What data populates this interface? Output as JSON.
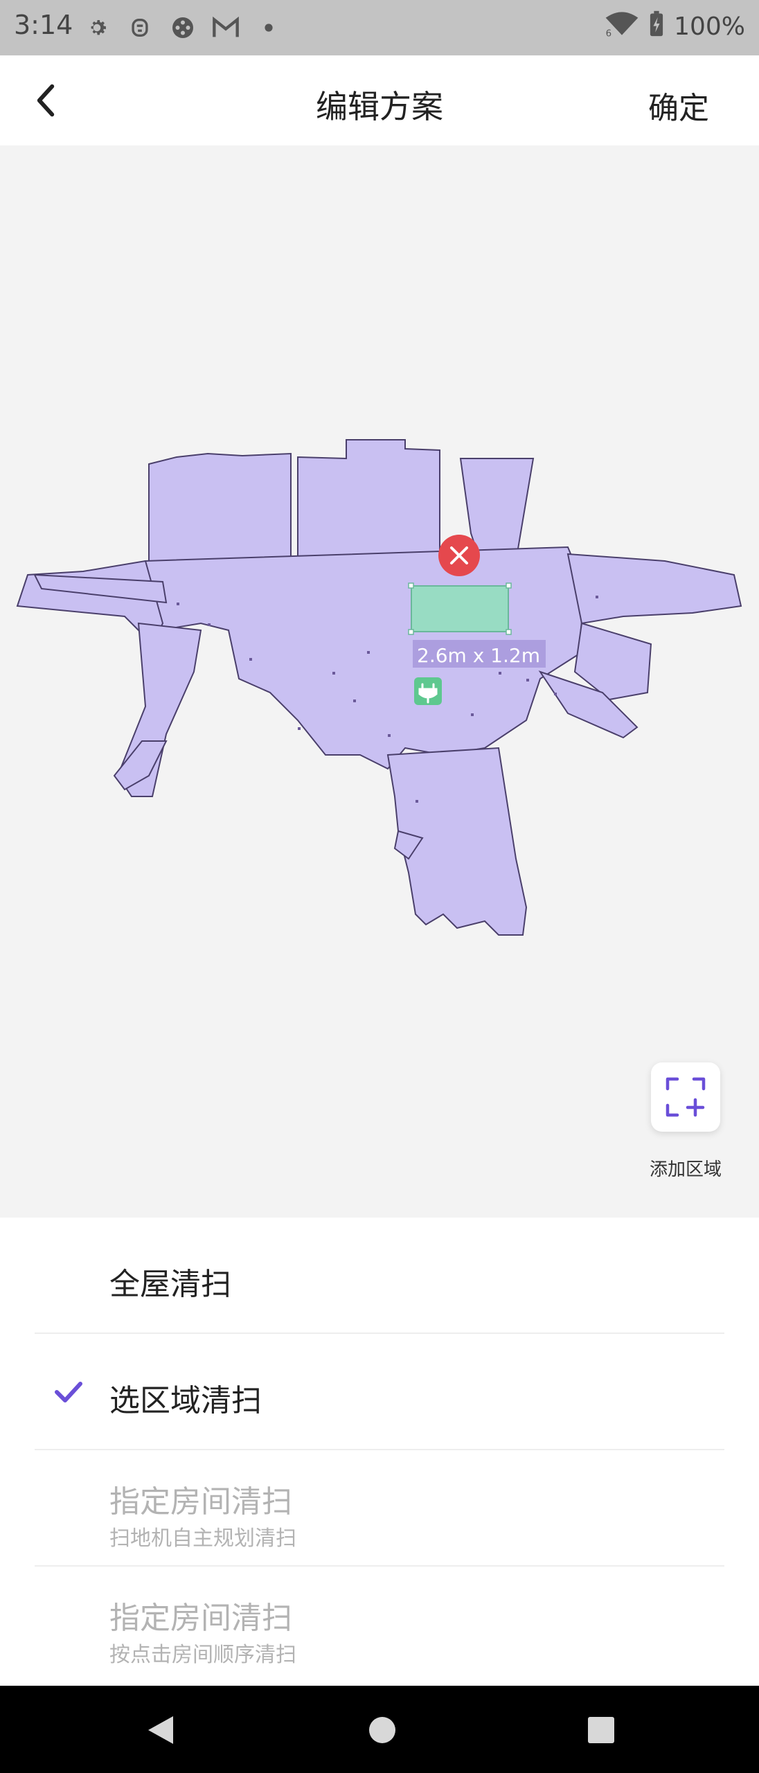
{
  "status_bar": {
    "time": "3:14",
    "battery": "100%",
    "icons": [
      "gear-icon",
      "robot-face-icon",
      "game-controller-icon",
      "gmail-icon",
      "dot-icon",
      "wifi-icon",
      "battery-charging-icon"
    ]
  },
  "header": {
    "title": "编辑方案",
    "confirm_label": "确定"
  },
  "map": {
    "zone_size_label": "2.6m x 1.2m",
    "add_area_label": "添加区域",
    "map_color": "#c9c0f2",
    "zone_color": "#98dcc3",
    "accent_color": "#6a4fd8",
    "delete_color": "#e5484d",
    "dock_color": "#5ec88f"
  },
  "modes": [
    {
      "title": "全屋清扫",
      "subtitle": "",
      "selected": false,
      "disabled": false
    },
    {
      "title": "选区域清扫",
      "subtitle": "",
      "selected": true,
      "disabled": false
    },
    {
      "title": "指定房间清扫",
      "subtitle": "扫地机自主规划清扫",
      "selected": false,
      "disabled": true
    },
    {
      "title": "指定房间清扫",
      "subtitle": "按点击房间顺序清扫",
      "selected": false,
      "disabled": true
    }
  ],
  "nav_bar": {
    "buttons": [
      "back-triangle-icon",
      "home-circle-icon",
      "recents-square-icon"
    ]
  }
}
